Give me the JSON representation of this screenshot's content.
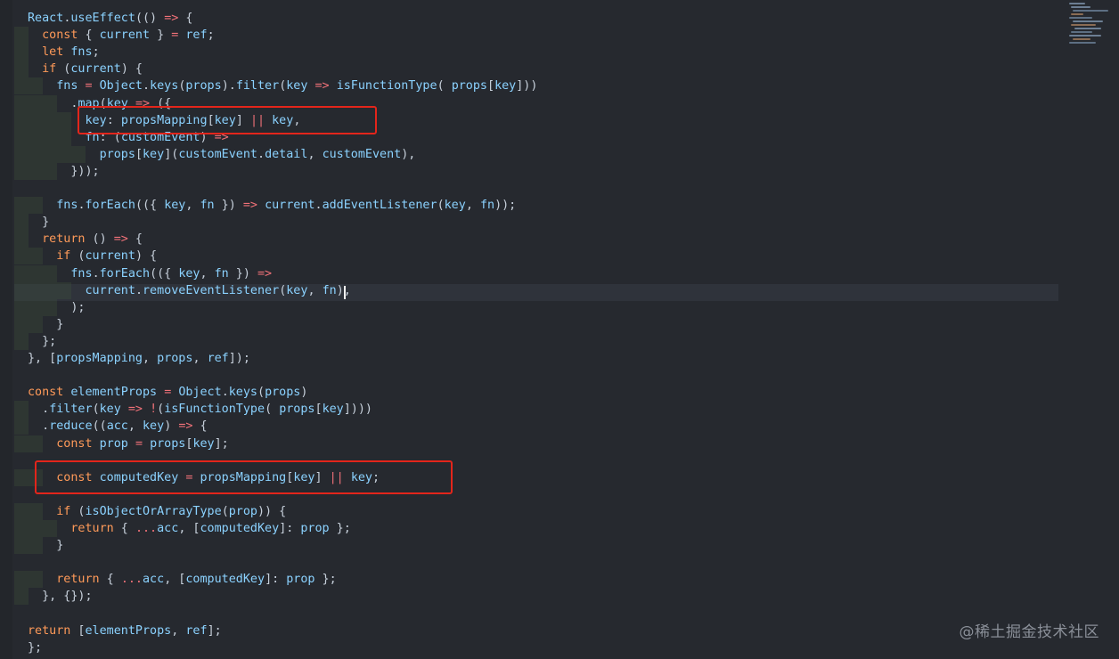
{
  "editor": {
    "lines": [
      "React.useEffect(() => {",
      "  const { current } = ref;",
      "  let fns;",
      "  if (current) {",
      "    fns = Object.keys(props).filter(key => isFunctionType( props[key]))",
      "      .map(key => ({",
      "        key: propsMapping[key] || key,",
      "        fn: (customEvent) =>",
      "          props[key](customEvent.detail, customEvent),",
      "      }));",
      "",
      "    fns.forEach(({ key, fn }) => current.addEventListener(key, fn));",
      "  }",
      "  return () => {",
      "    if (current) {",
      "      fns.forEach(({ key, fn }) =>",
      "        current.removeEventListener(key, fn),",
      "      );",
      "    }",
      "  };",
      "}, [propsMapping, props, ref]);",
      "",
      "const elementProps = Object.keys(props)",
      "  .filter(key => !(isFunctionType( props[key])))",
      "  .reduce((acc, key) => {",
      "    const prop = props[key];",
      "",
      "    const computedKey = propsMapping[key] || key;",
      "",
      "    if (isObjectOrArrayType(prop)) {",
      "      return { ...acc, [computedKey]: prop };",
      "    }",
      "",
      "    return { ...acc, [computedKey]: prop };",
      "  }, {});",
      "",
      "return [elementProps, ref];",
      "};"
    ]
  },
  "colors": {
    "background": "#26292f",
    "highlight_box": "#e3251b",
    "keyword": "#ff9a59",
    "identifier": "#8bd2ff",
    "property": "#ffbd5e"
  },
  "watermark": "@稀土掘金技术社区"
}
